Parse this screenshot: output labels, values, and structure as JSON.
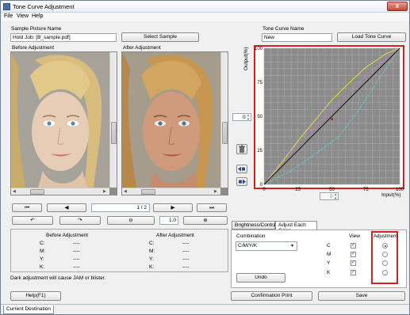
{
  "window": {
    "title": "Tone Curve Adjustment",
    "close_glyph": "x"
  },
  "menu": {
    "items": [
      "File",
      "View",
      "Help"
    ]
  },
  "sample": {
    "label": "Sample Picture Name",
    "value": "Hold Job: [B_sample.pdf]",
    "select_button": "Select Sample"
  },
  "tone_curve": {
    "label": "Tone Curve Name",
    "value": "New",
    "load_button": "Load Tone Curve"
  },
  "images": {
    "before_label": "Before Adjustment",
    "after_label": "After Adjustment"
  },
  "pager": {
    "current": "1",
    "separator": "/",
    "total": "2"
  },
  "zoom": {
    "value": "1.0"
  },
  "values_table": {
    "before_header": "Before Adjustment",
    "after_header": "After Adjustment",
    "rows": [
      {
        "label": "C:",
        "before": "----",
        "after": "----"
      },
      {
        "label": "M:",
        "before": "----",
        "after": "----"
      },
      {
        "label": "Y:",
        "before": "----",
        "after": "----"
      },
      {
        "label": "K:",
        "before": "----",
        "after": "----"
      }
    ]
  },
  "warning_text": "Dark adjustment will cause JAM or blister.",
  "graph": {
    "y_label": "Output(%)",
    "x_label": "Input(%)",
    "ticks": [
      "0",
      "25",
      "50",
      "75",
      "100"
    ],
    "spin_left_value": "0",
    "spin_bottom_value": "0",
    "curve_colors": {
      "cyan": "#55dede",
      "magenta": "#e070e0",
      "yellow": "#e6e640",
      "black": "#000000",
      "frame": "#d42020"
    }
  },
  "tabs": {
    "items": [
      "Brightness/Contrast",
      "Adjust Each Color"
    ],
    "active": 1
  },
  "adjust": {
    "combination_label": "Combination",
    "combination_value": "C/M/Y/K",
    "view_header": "View",
    "adjustment_header": "Adjustment",
    "channels": [
      {
        "name": "C",
        "view": true,
        "selected": true
      },
      {
        "name": "M",
        "view": true,
        "selected": false
      },
      {
        "name": "Y",
        "view": true,
        "selected": false
      },
      {
        "name": "K",
        "view": true,
        "selected": false
      }
    ],
    "check_glyph": "✓",
    "undo_button": "Undo"
  },
  "footer": {
    "help_button": "Help(F1)",
    "confirm_button": "Confirmation Print",
    "save_button": "Save",
    "status_tab": "Current Destination"
  },
  "icons": [
    "trash-icon",
    "curve-point-left-icon",
    "curve-point-right-icon",
    "first-page-icon",
    "prev-page-icon",
    "next-page-icon",
    "last-page-icon",
    "rotate-left-icon",
    "rotate-right-icon",
    "zoom-out-icon",
    "zoom-in-icon"
  ]
}
